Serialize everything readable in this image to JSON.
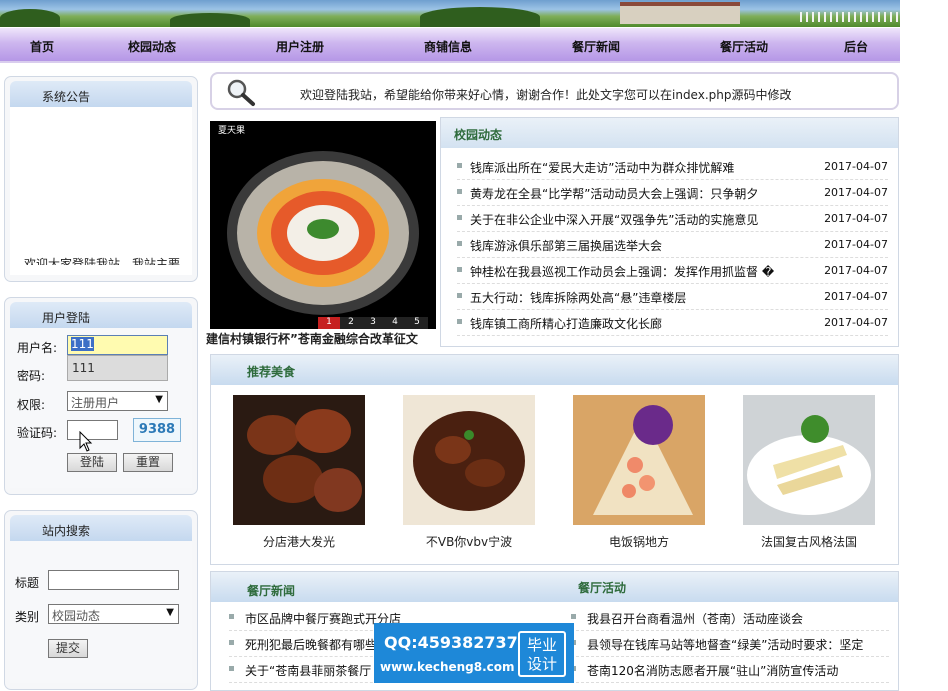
{
  "nav": {
    "items": [
      "首页",
      "校园动态",
      "用户注册",
      "商铺信息",
      "餐厅新闻",
      "餐厅活动",
      "后台"
    ]
  },
  "announcement": {
    "title": "系统公告",
    "scroll_text": "欢迎大家登陆我站，我站主要"
  },
  "login": {
    "title": "用户登陆",
    "username_label": "用户名:",
    "username_value": "111",
    "autocomplete_option": "111",
    "password_label": "密码:",
    "role_label": "权限:",
    "role_selected": "注册用户",
    "captcha_label": "验证码:",
    "captcha_code": "9388",
    "login_button": "登陆",
    "reset_button": "重置"
  },
  "search": {
    "title": "站内搜索",
    "title_label": "标题",
    "category_label": "类别",
    "category_selected": "校园动态",
    "submit_button": "提交"
  },
  "welcome": {
    "text": "欢迎登陆我站，希望能给你带来好心情，谢谢合作！此处文字您可以在index.php源码中修改"
  },
  "slideshow": {
    "caption": "建信村镇银行杯”苍南金融综合改革征文",
    "overlay_label": "夏天果",
    "pages": [
      "1",
      "2",
      "3",
      "4",
      "5"
    ],
    "active_page": "1"
  },
  "campus_news": {
    "title": "校园动态",
    "items": [
      {
        "title": "钱库派出所在“爱民大走访”活动中为群众排忧解难",
        "date": "2017-04-07"
      },
      {
        "title": "黄寿龙在全县“比学帮”活动动员大会上强调：只争朝夕",
        "date": "2017-04-07"
      },
      {
        "title": "关于在非公企业中深入开展“双强争先”活动的实施意见",
        "date": "2017-04-07"
      },
      {
        "title": "钱库游泳俱乐部第三届换届选举大会",
        "date": "2017-04-07"
      },
      {
        "title": "钟桂松在我县巡视工作动员会上强调：发挥作用抓监督 �",
        "date": "2017-04-07"
      },
      {
        "title": "五大行动：钱库拆除两处高“悬”违章楼层",
        "date": "2017-04-07"
      },
      {
        "title": "钱库镇工商所精心打造廉政文化长廊",
        "date": "2017-04-07"
      }
    ]
  },
  "recommended_food": {
    "title": "推荐美食",
    "items": [
      {
        "name": "分店港大发光"
      },
      {
        "name": "不VB你vbv宁波"
      },
      {
        "name": "电饭锅地方"
      },
      {
        "name": "法国复古风格法国"
      }
    ]
  },
  "restaurant_news": {
    "title": "餐厅新闻",
    "items": [
      "市区品牌中餐厅赛跑式开分店",
      "死刑犯最后晚餐都有哪些",
      "关于“苍南县菲丽茶餐厅"
    ]
  },
  "restaurant_events": {
    "title": "餐厅活动",
    "items": [
      "我县召开台商看温州（苍南）活动座谈会",
      "县领导在钱库马站等地督查“绿美”活动时要求：坚定",
      "苍南120名消防志愿者开展“驻山”消防宣传活动"
    ]
  },
  "watermark": {
    "qq": "QQ:459382737",
    "url": "www.kecheng8.com",
    "badge_line1": "毕业",
    "badge_line2": "设计"
  },
  "colors": {
    "nav_purple": "#b597e6",
    "panel_blue": "#c4d8ef",
    "heading_green": "#2e6b3c",
    "watermark_blue": "#1e88d8"
  }
}
